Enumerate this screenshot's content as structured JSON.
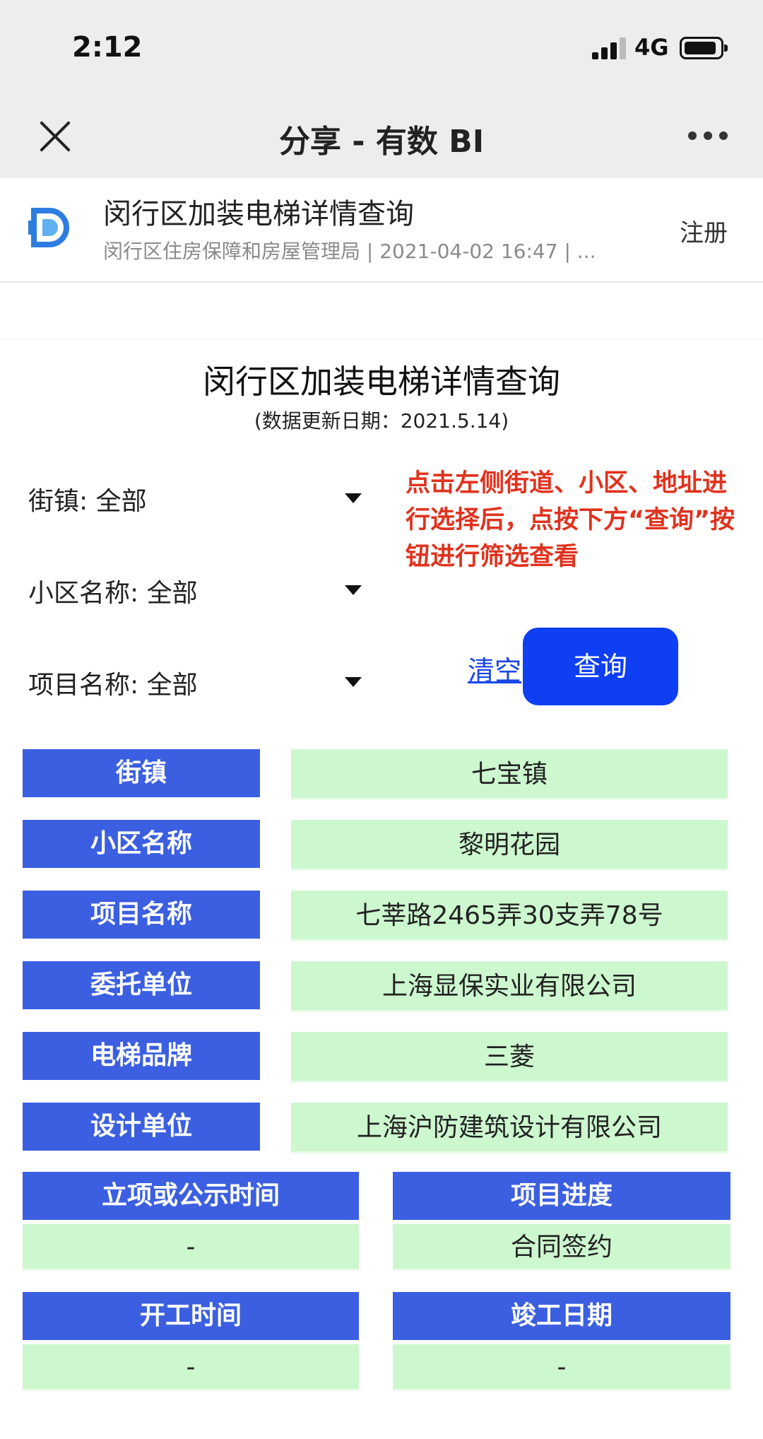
{
  "status_bar": {
    "time": "2:12",
    "network": "4G"
  },
  "nav": {
    "title": "分享 - 有数 BI"
  },
  "share": {
    "title": "闵行区加装电梯详情查询",
    "subtitle": "闵行区住房保障和房屋管理局 | 2021-04-02 16:47 | ...",
    "register": "注册"
  },
  "report": {
    "title": "闵行区加装电梯详情查询",
    "date": "(数据更新日期：2021.5.14)"
  },
  "filters": {
    "street": "街镇: 全部",
    "community": "小区名称: 全部",
    "project": "项目名称: 全部"
  },
  "hint": "点击左侧街道、小区、地址进行选择后，点按下方“查询”按钮进行筛选查看",
  "actions": {
    "clear": "清空",
    "query": "查询"
  },
  "details": [
    {
      "label": "街镇",
      "value": "七宝镇"
    },
    {
      "label": "小区名称",
      "value": "黎明花园"
    },
    {
      "label": "项目名称",
      "value": "七莘路2465弄30支弄78号"
    },
    {
      "label": "委托单位",
      "value": "上海显保实业有限公司"
    },
    {
      "label": "电梯品牌",
      "value": "三菱"
    },
    {
      "label": "设计单位",
      "value": "上海沪防建筑设计有限公司"
    }
  ],
  "grid": [
    {
      "label": "立项或公示时间",
      "value": "-"
    },
    {
      "label": "项目进度",
      "value": "合同签约"
    },
    {
      "label": "开工时间",
      "value": "-"
    },
    {
      "label": "竣工日期",
      "value": "-"
    }
  ],
  "colors": {
    "label_bg": "#3b5fe0",
    "value_bg": "#cdf7cf",
    "hint_text": "#e0321e",
    "query_button": "#0f3ff2",
    "logo_blue": "#2d7de0"
  }
}
